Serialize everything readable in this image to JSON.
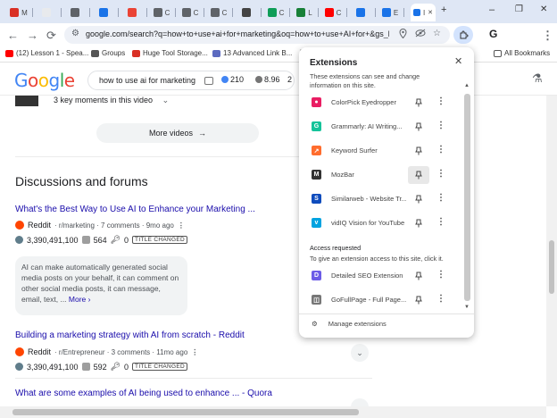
{
  "browser": {
    "tabs": [
      {
        "label": "M",
        "color": "#d93025"
      },
      {
        "label": "",
        "color": "#e8eaed"
      },
      {
        "label": "",
        "color": "#5f6368"
      },
      {
        "label": "",
        "color": "#1a73e8"
      },
      {
        "label": "",
        "color": "#ea4335"
      },
      {
        "label": "C",
        "color": "#5f6368"
      },
      {
        "label": "C",
        "color": "#5f6368"
      },
      {
        "label": "C",
        "color": "#5f6368"
      },
      {
        "label": "",
        "color": "#444"
      },
      {
        "label": "C",
        "color": "#0f9d58"
      },
      {
        "label": "L",
        "color": "#188038"
      },
      {
        "label": "C",
        "color": "#ff0000"
      },
      {
        "label": "",
        "color": "#1a73e8"
      },
      {
        "label": "E",
        "color": "#1a73e8"
      }
    ],
    "active_tab_label": "I",
    "new_tab": "+",
    "window_controls": {
      "chevron": "⌄",
      "minimize": "–",
      "restore": "❐",
      "close": "✕"
    },
    "toolbar": {
      "back": "←",
      "forward": "→",
      "reload": "⟳",
      "url": "google.com/search?q=how+to+use+ai+for+marketing&oq=how+to+use+AI+for+&gs_l...",
      "profile_letter": "G",
      "menu": "⋮"
    },
    "bookmarks": [
      {
        "label": "(12) Lesson 1 - Spea...",
        "color": "#ff0000"
      },
      {
        "label": "Groups",
        "color": "#555"
      },
      {
        "label": "Huge Tool Storage...",
        "color": "#d93025"
      },
      {
        "label": "13 Advanced Link B...",
        "color": "#5c6bc0"
      },
      {
        "label": "",
        "color": "#888"
      }
    ],
    "all_bookmarks": "All Bookmarks"
  },
  "google": {
    "logo": "Google",
    "query": "how to use ai for marketing",
    "metric1": "210",
    "metric2": "8.96",
    "metric3": "2"
  },
  "results": {
    "moments": "3 key moments in this video",
    "more_videos": "More videos",
    "section_title": "Discussions and forums",
    "items": [
      {
        "title": "What's the Best Way to Use AI to Enhance your Marketing ...",
        "site": "Reddit",
        "meta": "· r/marketing · 7 comments · 9mo ago",
        "reach": "3,390,491,100",
        "count": "564",
        "links": "0",
        "badge": "TITLE CHANGED"
      },
      {
        "title": "Building a marketing strategy with AI from scratch - Reddit",
        "site": "Reddit",
        "meta": "· r/Entrepreneur · 3 comments · 11mo ago",
        "reach": "3,390,491,100",
        "count": "592",
        "links": "0",
        "badge": "TITLE CHANGED"
      },
      {
        "title": "What are some examples of AI being used to enhance ... - Quora"
      }
    ],
    "snippet": "AI can make automatically generated social media posts on your behalf, it can comment on other social media posts, it can message, email, text, ...",
    "snippet_more": "More ›"
  },
  "extensions": {
    "title": "Extensions",
    "description": "These extensions can see and change information on this site.",
    "list": [
      {
        "name": "ColorPick Eyedropper",
        "color": "#e91e63",
        "glyph": "●",
        "pinned_highlight": false
      },
      {
        "name": "Grammarly: AI Writing...",
        "color": "#15c39a",
        "glyph": "G",
        "pinned_highlight": false
      },
      {
        "name": "Keyword Surfer",
        "color": "#ff6d2e",
        "glyph": "↗",
        "pinned_highlight": false
      },
      {
        "name": "MozBar",
        "color": "#333333",
        "glyph": "M",
        "pinned_highlight": true
      },
      {
        "name": "Similarweb - Website Tr...",
        "color": "#0f4cbd",
        "glyph": "S",
        "pinned_highlight": false
      },
      {
        "name": "vidIQ Vision for YouTube",
        "color": "#00a3e0",
        "glyph": "v",
        "pinned_highlight": false
      }
    ],
    "access_heading": "Access requested",
    "access_description": "To give an extension access to this site, click it.",
    "access_list": [
      {
        "name": "Detailed SEO Extension",
        "color": "#6c5ce7",
        "glyph": "D"
      },
      {
        "name": "GoFullPage - Full Page...",
        "color": "#777777",
        "glyph": "◫"
      }
    ],
    "manage": "Manage extensions"
  }
}
